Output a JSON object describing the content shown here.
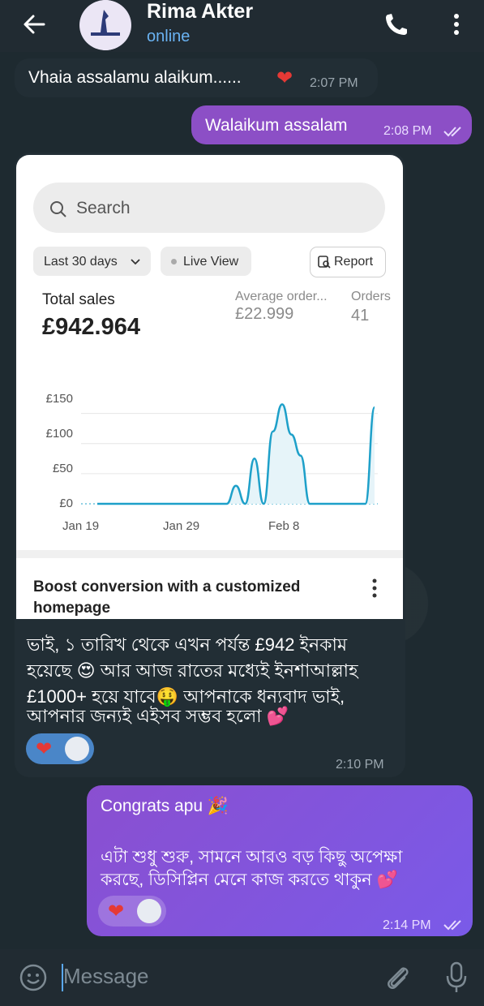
{
  "header": {
    "contact_name": "Rima Akter",
    "status": "online",
    "icons": [
      "back-arrow-icon",
      "avatar",
      "phone-icon",
      "more-vertical-icon"
    ]
  },
  "messages": {
    "m1": {
      "text": "Vhaia assalamu alaikum......",
      "emoji": "heart",
      "time": "2:07 PM"
    },
    "m2": {
      "text": "Walaikum assalam",
      "time": "2:08 PM"
    },
    "m3": {
      "lines": [
        "ভাই, ১ তারিখ থেকে এখন পর্যন্ত £942 ইনকাম",
        "হয়েছে 😍 আর আজ রাতের মধ্যেই ইনশাআল্লাহ",
        "£1000+ হয়ে যাবে🤑 আপনাকে ধন্যবাদ ভাই,",
        "আপনার জন্যই এইসব সম্ভব হলো 💕"
      ],
      "time": "2:10 PM"
    },
    "m4": {
      "line1": "Congrats apu 🎉",
      "lines": [
        "এটা শুধু শুরু, সামনে আরও বড় কিছু অপেক্ষা",
        "করছে, ডিসিপ্লিন মেনে কাজ করতে থাকুন 💕"
      ],
      "time": "2:14 PM"
    }
  },
  "card": {
    "search_placeholder": "Search",
    "range_label": "Last 30 days",
    "live_label": "Live View",
    "report_label": "Report",
    "total_sales_label": "Total sales",
    "total_sales_value": "£942.964",
    "avg_label": "Average order...",
    "avg_value": "£22.999",
    "orders_label": "Orders",
    "orders_value": "41",
    "boost_text": "Boost conversion with a customized homepage"
  },
  "chart_data": {
    "type": "line",
    "y_ticks": [
      "£150",
      "£100",
      "£50",
      "£0"
    ],
    "x_ticks": [
      "Jan 19",
      "Jan 29",
      "Feb 8"
    ],
    "ylim": [
      0,
      175
    ],
    "x": [
      0,
      1,
      2,
      3,
      4,
      5,
      6,
      7,
      8,
      9,
      10,
      11,
      12,
      13,
      14,
      15,
      16,
      17,
      18,
      19,
      20,
      21,
      22,
      23,
      24,
      25,
      26,
      27,
      28,
      29,
      30
    ],
    "values": [
      0,
      0,
      0,
      0,
      0,
      0,
      0,
      0,
      0,
      0,
      0,
      0,
      0,
      0,
      0,
      30,
      0,
      75,
      0,
      120,
      165,
      115,
      80,
      0,
      0,
      0,
      0,
      0,
      0,
      0,
      160
    ],
    "colors": {
      "line": "#1ea0c9",
      "area": "#e6f4f9"
    }
  },
  "input": {
    "placeholder": "Message"
  },
  "colors": {
    "accent": "#6ab3f3",
    "outgoing": "#8a4fd0",
    "incoming": "#222e35"
  }
}
